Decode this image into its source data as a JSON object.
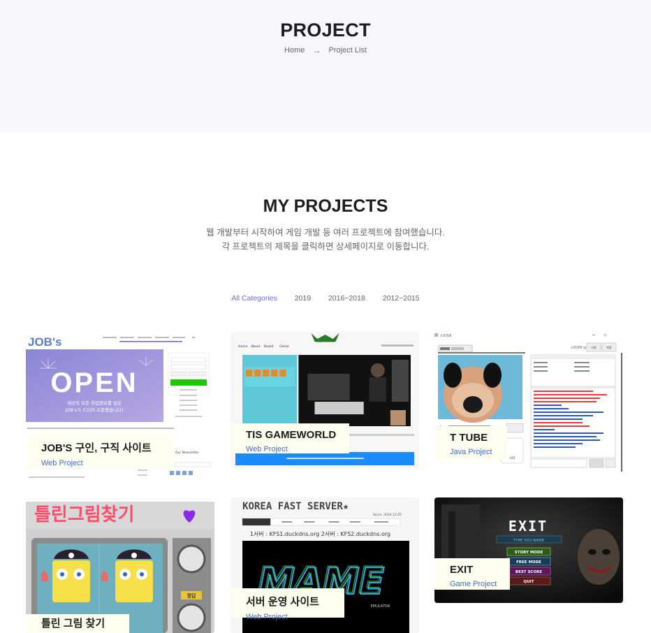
{
  "header": {
    "title": "PROJECT",
    "breadcrumb": {
      "home": "Home",
      "current": "Project List"
    }
  },
  "section": {
    "title": "MY PROJECTS",
    "desc_line1": "웹 개발부터 시작하여 게임 개발 등 여러 프로젝트에 참여했습니다.",
    "desc_line2": "각 프로젝트의 제목을 클릭하면 상세페이지로 이동합니다."
  },
  "filters": [
    "All Categories",
    "2019",
    "2016~2018",
    "2012~2015"
  ],
  "projects": [
    {
      "title": "JOB'S 구인, 구직 사이트",
      "category": "Web Project",
      "shot": {
        "logo": "JOB's",
        "banner": "OPEN",
        "banner_sub1": "세상의 모든 취업정보를 담은",
        "banner_sub2": "JOB's가 드디어 오픈했습니다!",
        "news": "Our Newsletter"
      }
    },
    {
      "title": "TIS GAMEWORLD",
      "category": "Web Project",
      "shot": {
        "logo": "GAMEWORLD",
        "nav": [
          "Home",
          "About",
          "Board",
          "Game"
        ],
        "tile": "퍼즐 퍼즐퍼즐"
      }
    },
    {
      "title": "T TUBE",
      "category": "Java Project",
      "shot": {
        "window_title": "스트리머",
        "side_header": "스트리머 님 안녕하세요!",
        "btns": [
          "닉변",
          "퇴장"
        ],
        "play": "시작"
      }
    },
    {
      "title": "틀린 그림 찾기",
      "category": "",
      "shot": {
        "banner": "틀린그림찾기",
        "badge": "정답"
      }
    },
    {
      "title": "서버 운영 사이트",
      "category": "Web Project",
      "shot": {
        "banner": "KOREA FAST SERVER★",
        "since": "Since. 2014.12.05",
        "servers": "1서버 : KFS1.duckdns.org    2서버 : KFS2.duckdns.org",
        "logo": "MAME",
        "logo_sub": "EMULATOR"
      }
    },
    {
      "title": "EXIT",
      "category": "Game Project",
      "shot": {
        "logo": "EXIT",
        "input": "TYPE YOU NAME",
        "menu": [
          "STORY MODE",
          "FREE MODE",
          "BEST SCORE",
          "QUIT"
        ]
      }
    }
  ],
  "colors": {
    "accent": "#6c6ce5",
    "link": "#3d6bd9",
    "hero_bg": "#f8f7fc",
    "label_bg": "#fffff0"
  }
}
